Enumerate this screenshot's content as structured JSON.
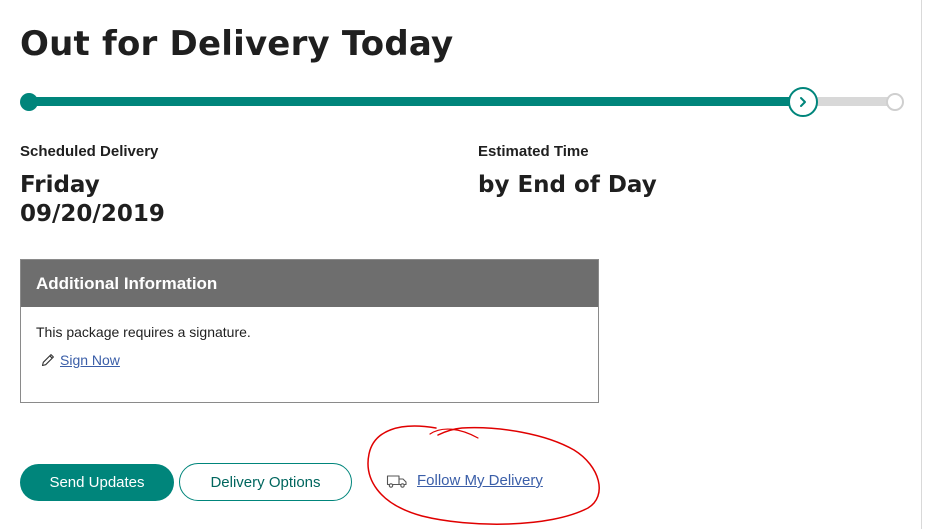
{
  "header": {
    "title": "Out for Delivery Today"
  },
  "progress": {
    "value": 0.9,
    "steps": 3,
    "current_step_icon": "chevron-right-icon",
    "accent_color": "#00857b",
    "track_color": "#d8d8d8"
  },
  "delivery": {
    "scheduled_label": "Scheduled Delivery",
    "scheduled_day": "Friday",
    "scheduled_date": "09/20/2019",
    "estimated_label": "Estimated Time",
    "estimated_value": "by End of Day"
  },
  "additional_info": {
    "heading": "Additional Information",
    "message": "This package requires a signature.",
    "sign_now_label": "Sign Now",
    "sign_now_icon": "pencil-icon",
    "header_color": "#6e6e6e"
  },
  "actions": {
    "send_updates_label": "Send Updates",
    "delivery_options_label": "Delivery Options",
    "follow_delivery_label": "Follow My Delivery",
    "follow_delivery_icon": "truck-icon",
    "link_color": "#3a5ea8"
  },
  "annotation": {
    "shape": "freehand-circle",
    "color": "#e00000"
  }
}
